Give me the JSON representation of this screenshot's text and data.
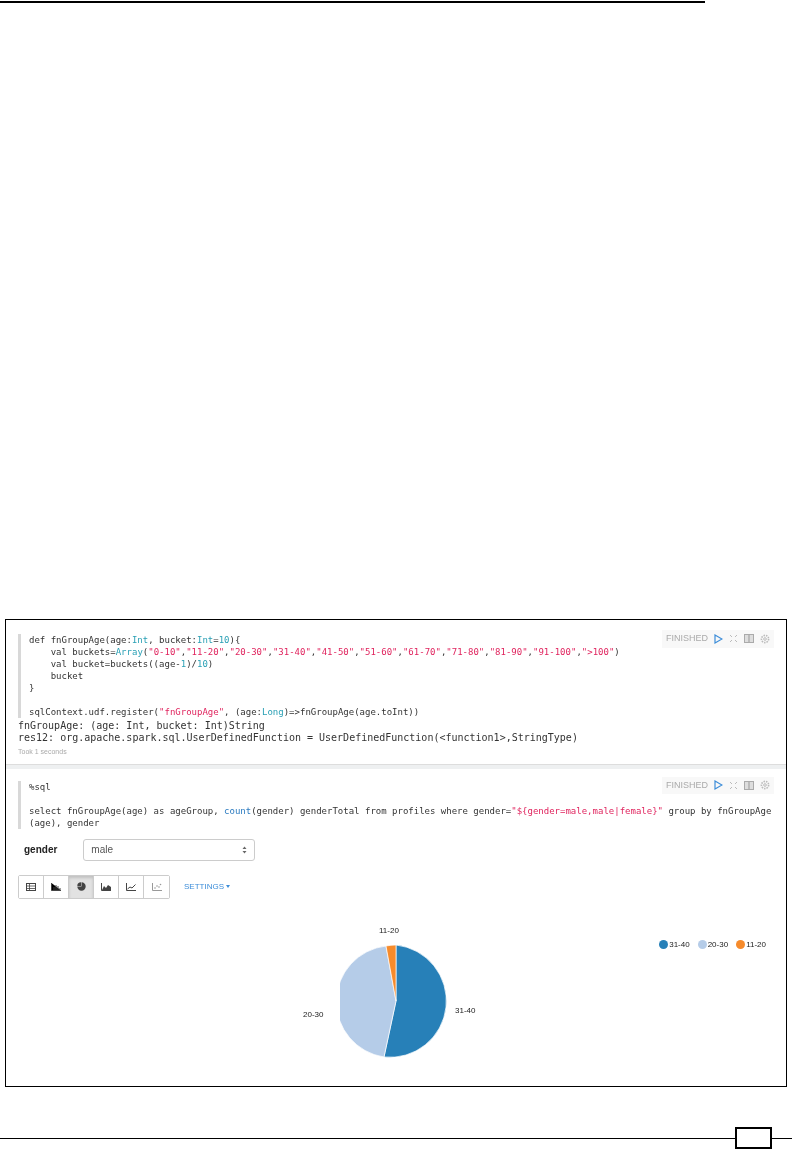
{
  "paragraphs": [
    {
      "status": "FINISHED",
      "code": [
        [
          {
            "kind": "plain",
            "text": "def fnGroupAge(age:"
          },
          {
            "kind": "type",
            "text": "Int"
          },
          {
            "kind": "plain",
            "text": ", bucket:"
          },
          {
            "kind": "type",
            "text": "Int"
          },
          {
            "kind": "plain",
            "text": "="
          },
          {
            "kind": "num",
            "text": "10"
          },
          {
            "kind": "plain",
            "text": "){"
          }
        ],
        [
          {
            "kind": "plain",
            "text": "    val buckets="
          },
          {
            "kind": "type",
            "text": "Array"
          },
          {
            "kind": "plain",
            "text": "("
          },
          {
            "kind": "str",
            "text": "\"0-10\""
          },
          {
            "kind": "plain",
            "text": ","
          },
          {
            "kind": "str",
            "text": "\"11-20\""
          },
          {
            "kind": "plain",
            "text": ","
          },
          {
            "kind": "str",
            "text": "\"20-30\""
          },
          {
            "kind": "plain",
            "text": ","
          },
          {
            "kind": "str",
            "text": "\"31-40\""
          },
          {
            "kind": "plain",
            "text": ","
          },
          {
            "kind": "str",
            "text": "\"41-50\""
          },
          {
            "kind": "plain",
            "text": ","
          },
          {
            "kind": "str",
            "text": "\"51-60\""
          },
          {
            "kind": "plain",
            "text": ","
          },
          {
            "kind": "str",
            "text": "\"61-70\""
          },
          {
            "kind": "plain",
            "text": ","
          },
          {
            "kind": "str",
            "text": "\"71-80\""
          },
          {
            "kind": "plain",
            "text": ","
          },
          {
            "kind": "str",
            "text": "\"81-90\""
          },
          {
            "kind": "plain",
            "text": ","
          },
          {
            "kind": "str",
            "text": "\"91-100\""
          },
          {
            "kind": "plain",
            "text": ","
          },
          {
            "kind": "str",
            "text": "\">100\""
          },
          {
            "kind": "plain",
            "text": ")"
          }
        ],
        [
          {
            "kind": "plain",
            "text": "    val bucket=buckets((age-"
          },
          {
            "kind": "num",
            "text": "1"
          },
          {
            "kind": "plain",
            "text": ")/"
          },
          {
            "kind": "num",
            "text": "10"
          },
          {
            "kind": "plain",
            "text": ")"
          }
        ],
        [
          {
            "kind": "plain",
            "text": "    bucket"
          }
        ],
        [
          {
            "kind": "plain",
            "text": "}"
          }
        ],
        [
          {
            "kind": "gap"
          },
          {
            "kind": "plain",
            "text": "sqlContext.udf.register("
          },
          {
            "kind": "str",
            "text": "\"fnGroupAge\""
          },
          {
            "kind": "plain",
            "text": ", (age:"
          },
          {
            "kind": "type",
            "text": "Long"
          },
          {
            "kind": "plain",
            "text": ")=>fnGroupAge(age.toInt))"
          }
        ]
      ],
      "output": [
        "fnGroupAge: (age: Int, bucket: Int)String",
        "res12: org.apache.spark.sql.UserDefinedFunction = UserDefinedFunction(<function1>,StringType)"
      ],
      "took": "Took 1 seconds"
    },
    {
      "status": "FINISHED",
      "code": [
        [
          {
            "kind": "plain",
            "text": "%sql"
          }
        ],
        [
          {
            "kind": "gap"
          },
          {
            "kind": "plain",
            "text": "select fnGroupAge(age) as ageGroup, "
          },
          {
            "kind": "fn",
            "text": "count"
          },
          {
            "kind": "plain",
            "text": "(gender) genderTotal from profiles where gender="
          },
          {
            "kind": "str",
            "text": "\"${gender=male,male|female}\""
          },
          {
            "kind": "plain",
            "text": " group by fnGroupAge"
          }
        ],
        [
          {
            "kind": "plain",
            "text": "(age), gender"
          }
        ]
      ],
      "form": {
        "label": "gender",
        "value": "male"
      },
      "chart_buttons": [
        {
          "kind": "table",
          "selected": false
        },
        {
          "kind": "bar",
          "selected": false
        },
        {
          "kind": "pie",
          "selected": true
        },
        {
          "kind": "area",
          "selected": false
        },
        {
          "kind": "line",
          "selected": false
        },
        {
          "kind": "scatter",
          "selected": false
        }
      ],
      "settings": "SETTINGS",
      "legend": [
        {
          "label": "31-40",
          "color": "#2780b8"
        },
        {
          "label": "20-30",
          "color": "#b5cce8"
        },
        {
          "label": "11-20",
          "color": "#f68b2c"
        }
      ],
      "pie_labels": [
        "11-20",
        "20-30",
        "31-40"
      ]
    }
  ]
}
